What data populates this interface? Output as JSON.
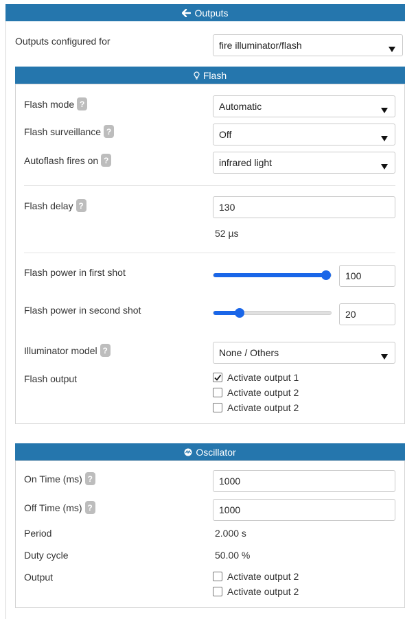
{
  "outputs": {
    "title": "Outputs",
    "configured_label": "Outputs configured for",
    "configured_value": "fire illuminator/flash"
  },
  "flash": {
    "title": "Flash",
    "mode": {
      "label": "Flash mode",
      "value": "Automatic"
    },
    "surveillance": {
      "label": "Flash surveillance",
      "value": "Off"
    },
    "autoflash": {
      "label": "Autoflash fires on",
      "value": "infrared light"
    },
    "delay": {
      "label": "Flash delay",
      "value": "130",
      "computed": "52 µs"
    },
    "power_first": {
      "label": "Flash power in first shot",
      "value": "100",
      "level": 100
    },
    "power_second": {
      "label": "Flash power in second shot",
      "value": "20",
      "level": 20
    },
    "illuminator": {
      "label": "Illuminator model",
      "value": "None / Others"
    },
    "output": {
      "label": "Flash output",
      "options": [
        {
          "label": "Activate output 1",
          "checked": true
        },
        {
          "label": "Activate output 2",
          "checked": false
        },
        {
          "label": "Activate output 2",
          "checked": false
        }
      ]
    }
  },
  "oscillator": {
    "title": "Oscillator",
    "on_time": {
      "label": "On Time (ms)",
      "value": "1000"
    },
    "off_time": {
      "label": "Off Time (ms)",
      "value": "1000"
    },
    "period": {
      "label": "Period",
      "value": "2.000 s"
    },
    "duty": {
      "label": "Duty cycle",
      "value": "50.00 %"
    },
    "output": {
      "label": "Output",
      "options": [
        {
          "label": "Activate output 2",
          "checked": false
        },
        {
          "label": "Activate output 2",
          "checked": false
        }
      ]
    }
  },
  "help_glyph": "?",
  "colors": {
    "header": "#2576ad",
    "slider": "#1a66e8"
  },
  "icons": {
    "outputs": "arrow-left-icon",
    "flash": "lightbulb-icon",
    "oscillator": "oscillator-icon",
    "select": "caret-down-icon"
  }
}
